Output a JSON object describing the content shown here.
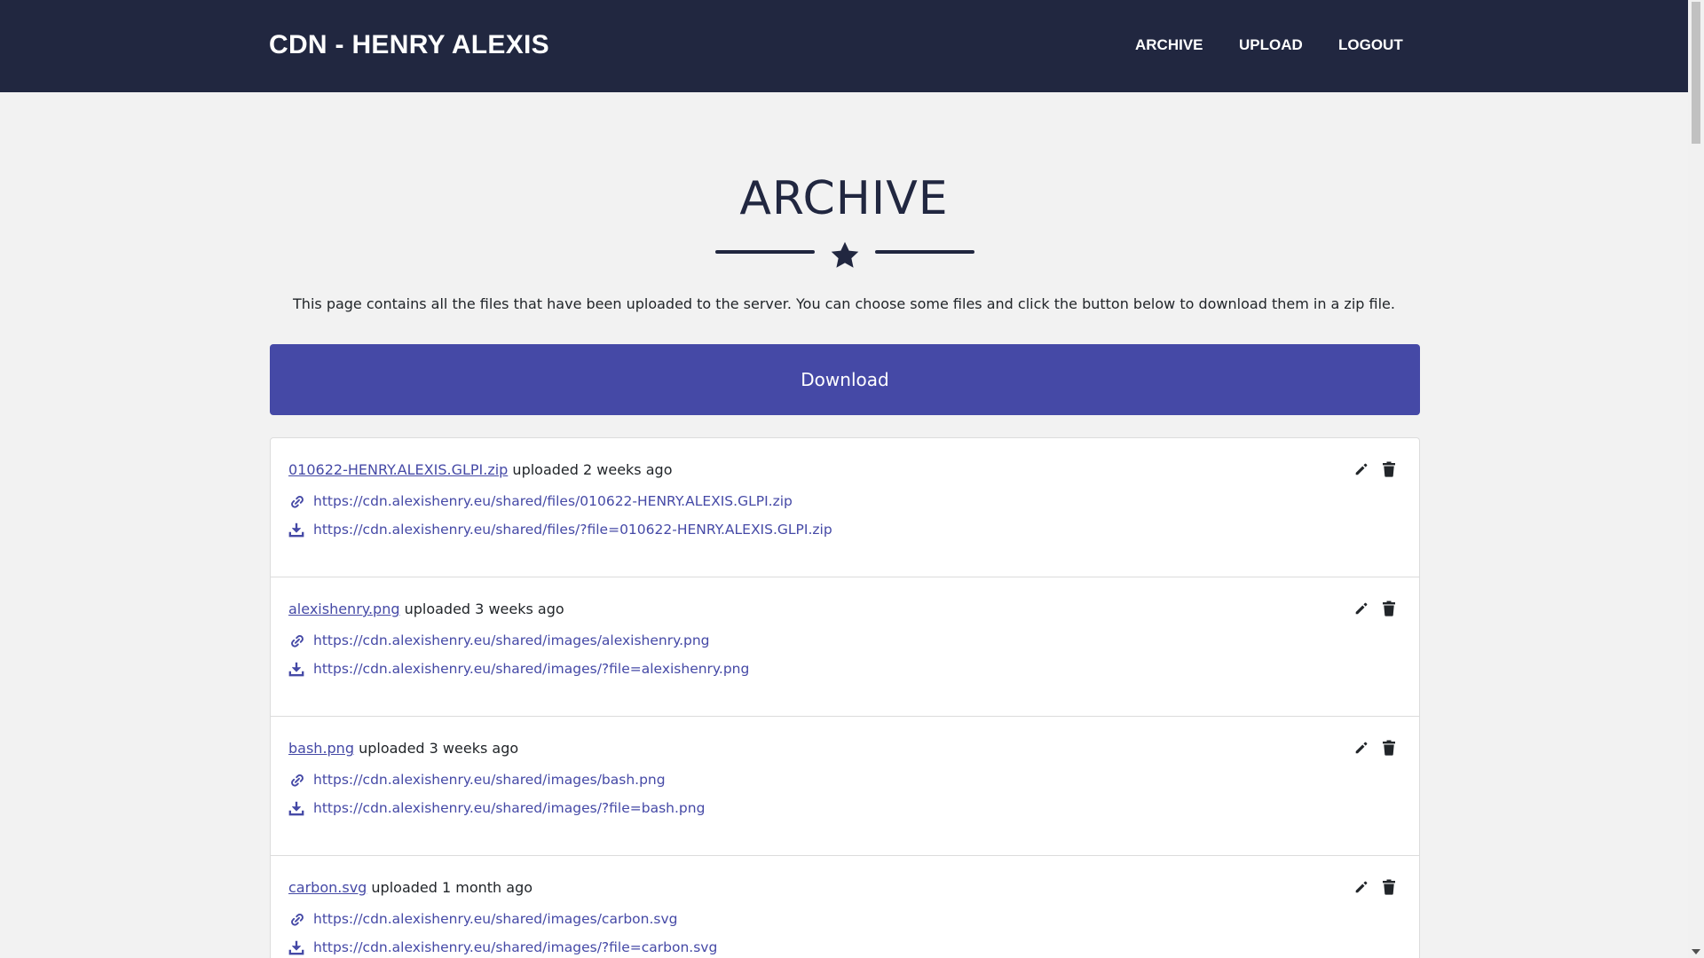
{
  "header": {
    "brand": "CDN - HENRY ALEXIS",
    "nav": [
      {
        "label": "ARCHIVE"
      },
      {
        "label": "UPLOAD"
      },
      {
        "label": "LOGOUT"
      }
    ],
    "bg_color": "#212740"
  },
  "main": {
    "title": "ARCHIVE",
    "intro": "This page contains all the files that have been uploaded to the server. You can choose some files and click the button below to download them in a zip file.",
    "download_label": "Download",
    "accent_color": "#4549a6",
    "files": [
      {
        "name": "010622-HENRY.ALEXIS.GLPI.zip",
        "uploaded": "uploaded 2 weeks ago",
        "link": "https://cdn.alexishenry.eu/shared/files/010622-HENRY.ALEXIS.GLPI.zip",
        "download": "https://cdn.alexishenry.eu/shared/files/?file=010622-HENRY.ALEXIS.GLPI.zip"
      },
      {
        "name": "alexishenry.png",
        "uploaded": "uploaded 3 weeks ago",
        "link": "https://cdn.alexishenry.eu/shared/images/alexishenry.png",
        "download": "https://cdn.alexishenry.eu/shared/images/?file=alexishenry.png"
      },
      {
        "name": "bash.png",
        "uploaded": "uploaded 3 weeks ago",
        "link": "https://cdn.alexishenry.eu/shared/images/bash.png",
        "download": "https://cdn.alexishenry.eu/shared/images/?file=bash.png"
      },
      {
        "name": "carbon.svg",
        "uploaded": "uploaded 1 month ago",
        "link": "https://cdn.alexishenry.eu/shared/images/carbon.svg",
        "download": "https://cdn.alexishenry.eu/shared/images/?file=carbon.svg"
      }
    ]
  },
  "icons": {
    "divider": "star-icon",
    "link": "link-icon",
    "download": "download-icon",
    "edit": "pencil-icon",
    "delete": "trash-icon"
  }
}
